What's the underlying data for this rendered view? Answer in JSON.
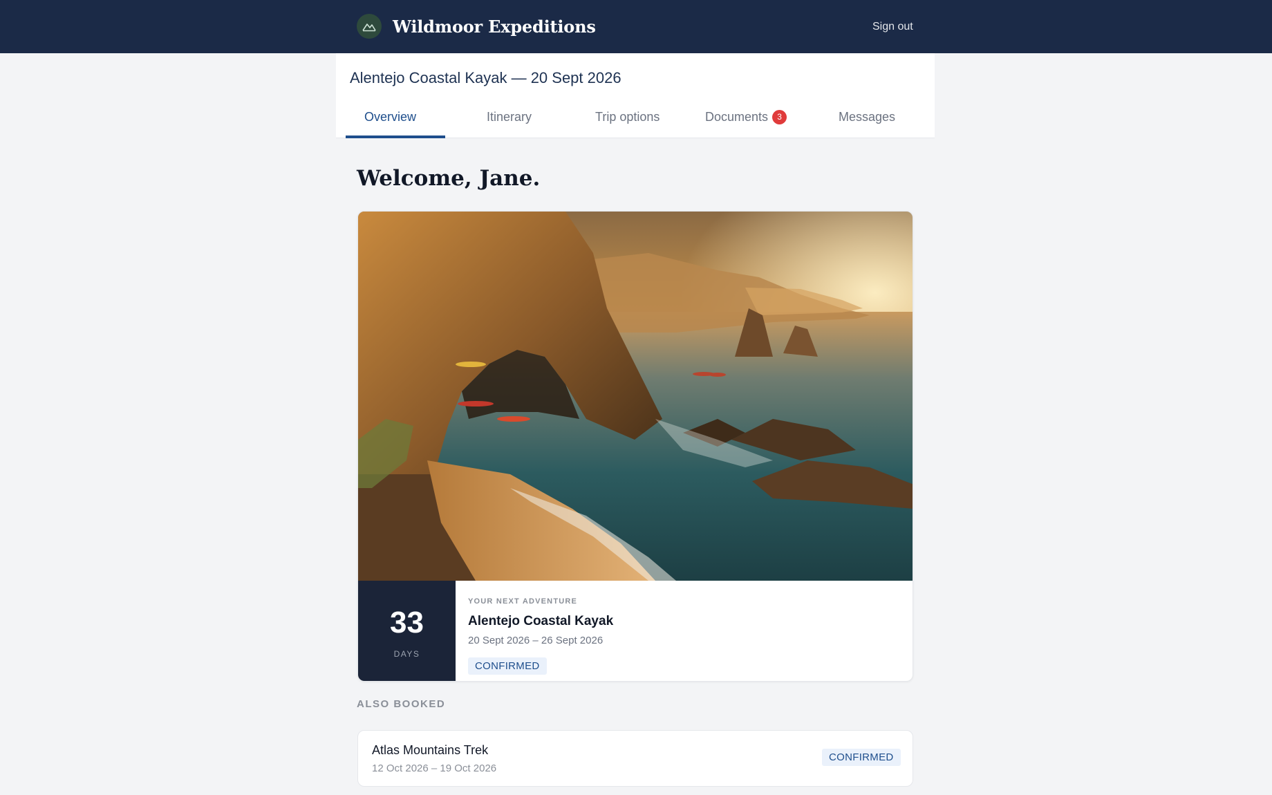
{
  "header": {
    "brand": "Wildmoor Expeditions",
    "logo_icon": "mountain-icon",
    "signout_label": "Sign out"
  },
  "trip": {
    "title": "Alentejo Coastal Kayak — 20 Sept 2026",
    "tabs": [
      {
        "label": "Overview",
        "active": true
      },
      {
        "label": "Itinerary"
      },
      {
        "label": "Trip options"
      },
      {
        "label": "Documents",
        "badge": "3"
      },
      {
        "label": "Messages"
      }
    ]
  },
  "welcome": "Welcome, Jane.",
  "next_adventure": {
    "countdown_value": "33",
    "countdown_unit": "DAYS",
    "eyebrow": "YOUR NEXT ADVENTURE",
    "name": "Alentejo Coastal Kayak",
    "dates": "20 Sept 2026 – 26 Sept 2026",
    "status": "CONFIRMED"
  },
  "also_booked": {
    "title": "ALSO BOOKED",
    "items": [
      {
        "name": "Atlas Mountains Trek",
        "dates": "12 Oct 2026 – 19 Oct 2026",
        "status": "CONFIRMED"
      }
    ]
  },
  "colors": {
    "header_bg": "#1b2a47",
    "accent": "#1e4e8c",
    "badge": "#e03b3b",
    "countdown_bg": "#1b2438"
  }
}
